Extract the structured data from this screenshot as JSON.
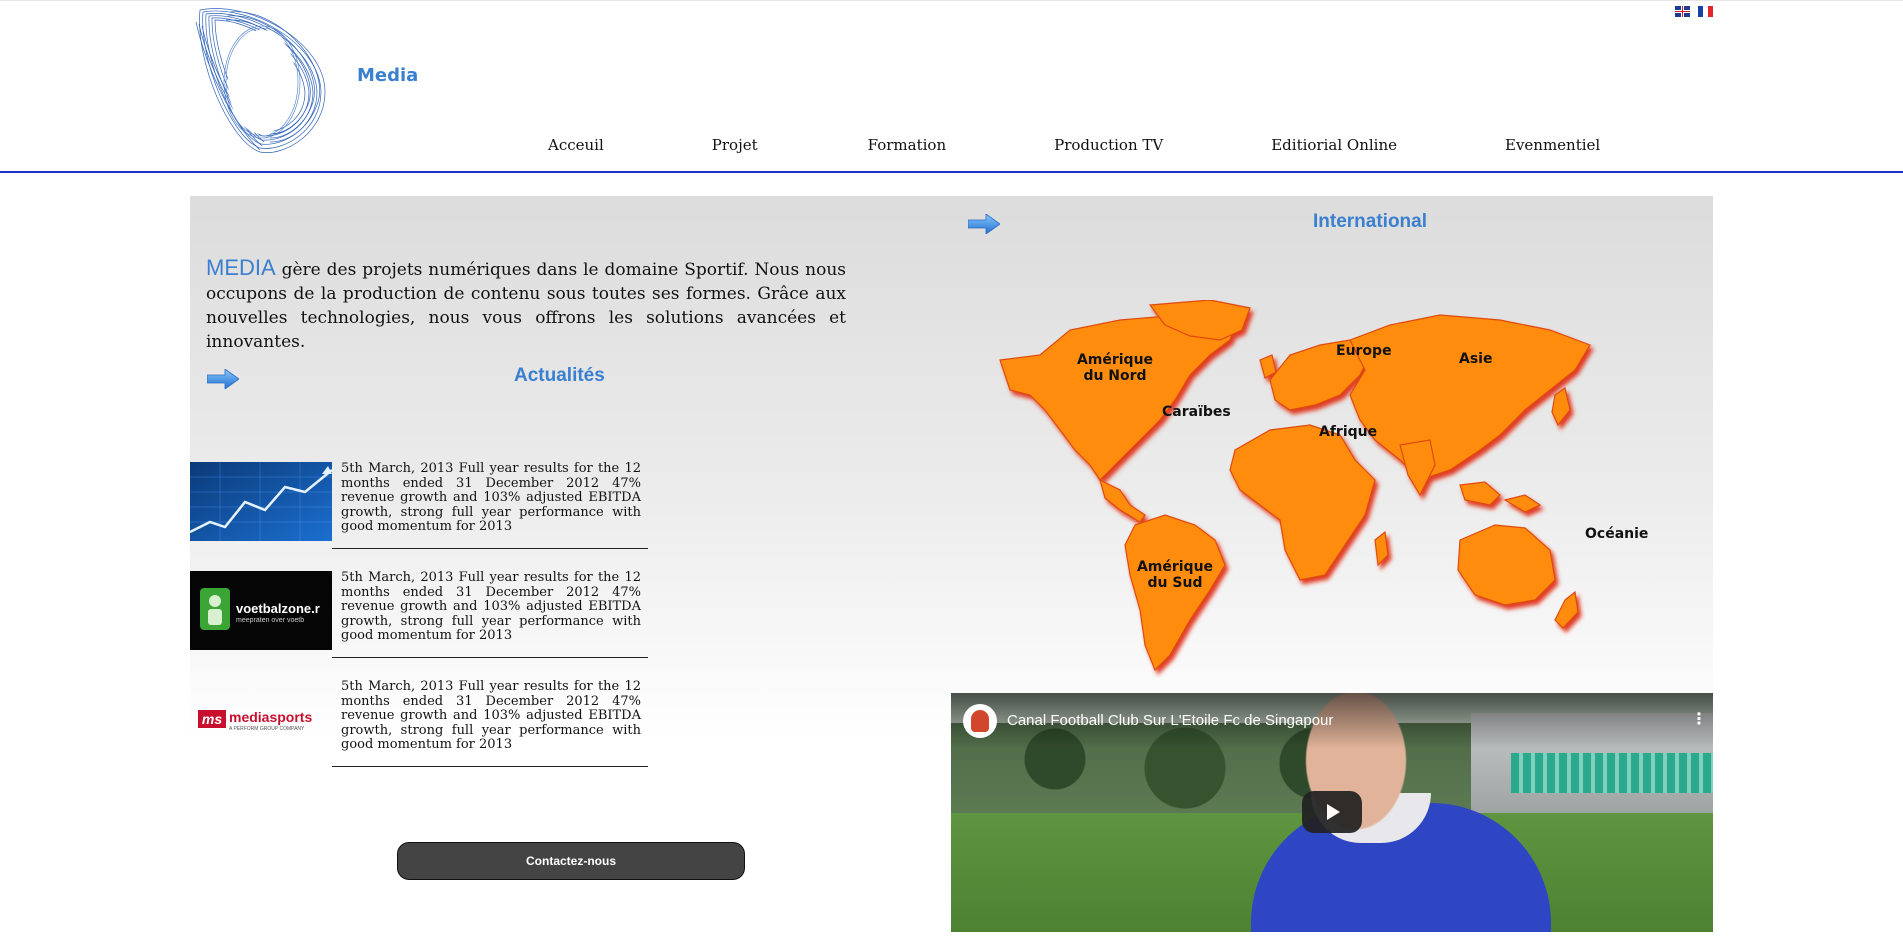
{
  "header": {
    "brand": "Media",
    "languages": [
      {
        "name": "english-flag",
        "colors": [
          "#1f3a93",
          "#ffffff",
          "#d0202a"
        ]
      },
      {
        "name": "french-flag",
        "colors": [
          "#1a3fa8",
          "#ffffff",
          "#e5232b"
        ]
      }
    ],
    "nav": [
      "Acceuil",
      "Projet",
      "Formation",
      "Production TV",
      "Editiorial Online",
      "Evenmentiel"
    ]
  },
  "intro": {
    "highlight": "MEDIA",
    "text": " gère des projets numériques dans le domaine Sportif. Nous nous occupons de la production de contenu sous toutes ses formes. Grâce aux nouvelles technologies, nous vous offrons les solutions avancées et innovantes."
  },
  "news": {
    "title": "Actualités",
    "items": [
      {
        "thumbnail": "stock-chart-image",
        "text": "5th March, 2013 Full year results for the 12 months ended 31 December 2012 47% revenue growth and 103% adjusted EBITDA growth, strong full year performance with good momentum for 2013"
      },
      {
        "thumbnail": "voetbalzone-logo",
        "logo_text": "voetbalzone.r",
        "logo_sub": "meepraten over voetb",
        "text": "5th March, 2013 Full year results for the 12 months ended 31 December 2012 47% revenue growth and 103% adjusted EBITDA growth, strong full year performance with good momentum for 2013"
      },
      {
        "thumbnail": "mediasports-logo",
        "logo_mark": "ms",
        "logo_text": "mediasports",
        "logo_sub": "A PERFORM GROUP COMPANY",
        "text": "5th March, 2013 Full year results for the 12 months ended 31 December 2012 47% revenue growth and 103% adjusted EBITDA growth, strong full year performance with good momentum for 2013"
      }
    ]
  },
  "contact": {
    "label": "Contactez-nous"
  },
  "international": {
    "title": "International",
    "map_color": "#ff8c0a",
    "regions": [
      "Amérique du Nord",
      "Caraïbes",
      "Europe",
      "Asie",
      "Afrique",
      "Amérique du Sud",
      "Océanie"
    ]
  },
  "video": {
    "title": "Canal Football Club Sur L'Etoile Fc de Singapour",
    "menu_icon": "more-vert-icon",
    "play_icon": "play-icon"
  },
  "colors": {
    "accent": "#3a7fd0",
    "nav_rule": "#2233cc",
    "button": "#444444"
  }
}
